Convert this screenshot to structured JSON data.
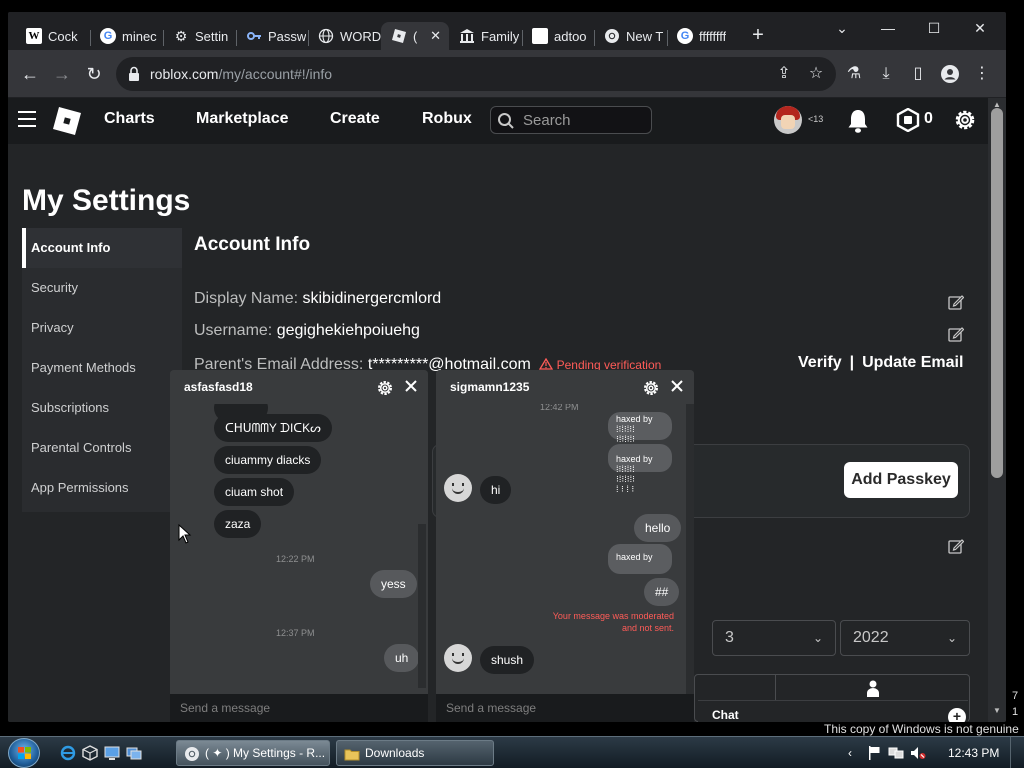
{
  "browser": {
    "tabs": [
      {
        "label": "Cock",
        "favicon": "wikipedia-icon"
      },
      {
        "label": "minec",
        "favicon": "google-icon"
      },
      {
        "label": "Settin",
        "favicon": "gear-icon"
      },
      {
        "label": "Passw",
        "favicon": "key-icon"
      },
      {
        "label": "WORD",
        "favicon": "globe-icon"
      },
      {
        "label": "(",
        "favicon": "roblox-icon",
        "active": true
      },
      {
        "label": "Family",
        "favicon": "building-icon"
      },
      {
        "label": "adtoo",
        "favicon": "blank-page-icon"
      },
      {
        "label": "New T",
        "favicon": "chrome-icon"
      },
      {
        "label": "ffffffff",
        "favicon": "google-icon"
      }
    ],
    "url_domain": "roblox.com",
    "url_path": "/my/account#!/info"
  },
  "roblox_nav": {
    "items": [
      "Charts",
      "Marketplace",
      "Create",
      "Robux"
    ],
    "search_placeholder": "Search",
    "age_label": "<13",
    "robux_count": "0"
  },
  "page": {
    "title": "My Settings",
    "menu": [
      "Account Info",
      "Security",
      "Privacy",
      "Payment Methods",
      "Subscriptions",
      "Parental Controls",
      "App Permissions"
    ],
    "active_menu": "Account Info"
  },
  "account": {
    "section_title": "Account Info",
    "display_name_label": "Display Name:",
    "display_name": "skibidinergercmlord",
    "username_label": "Username:",
    "username": "gegighekiehpoiuehg",
    "parent_email_label": "Parent's Email Address:",
    "parent_email": "t*********@hotmail.com",
    "pending_text": "Pending verification",
    "verify_label": "Verify",
    "link_sep": "|",
    "update_email_label": "Update Email",
    "add_passkey_label": "Add Passkey",
    "birth_day": "3",
    "birth_year": "2022"
  },
  "chat_left": {
    "name": "asfasfasd18",
    "messages": [
      {
        "from": "them",
        "text": "ᑕᕼᑌᗰᗰY ᗪIᑕKᔕ"
      },
      {
        "from": "them",
        "text": "ciuammy diacks"
      },
      {
        "from": "them",
        "text": "ciuam shot"
      },
      {
        "from": "them",
        "text": "zaza"
      },
      {
        "type": "time",
        "text": "12:22 PM"
      },
      {
        "from": "me",
        "text": "yess"
      },
      {
        "type": "time",
        "text": "12:37 PM"
      },
      {
        "from": "me",
        "text": "uh"
      }
    ],
    "input_placeholder": "Send a message"
  },
  "chat_right": {
    "name": "sigmamn1235",
    "partial_time": "12:42 PM",
    "messages": [
      {
        "from": "them",
        "text": "hi"
      },
      {
        "from": "me",
        "text": "hello"
      },
      {
        "from": "me",
        "text": "##"
      },
      {
        "type": "moderated",
        "line1": "Your message was moderated",
        "line2": "and not sent."
      },
      {
        "from": "them",
        "text": "shush"
      }
    ],
    "glitch_text": "haxed by",
    "input_placeholder": "Send a message"
  },
  "chat_bar": {
    "label": "Chat"
  },
  "windows": {
    "genuine_notice": "This copy of Windows is not genuine",
    "side_nums": [
      "7",
      "1"
    ],
    "task_buttons": [
      {
        "label": "( ✦ ) My Settings - R...",
        "active": true
      },
      {
        "label": "Downloads",
        "active": false
      }
    ],
    "clock": "12:43 PM"
  },
  "colors": {
    "roblox_bg": "#232527",
    "roblox_header": "#191b1d",
    "pending_red": "#ff5c58",
    "chrome_tabstrip": "#202124"
  }
}
